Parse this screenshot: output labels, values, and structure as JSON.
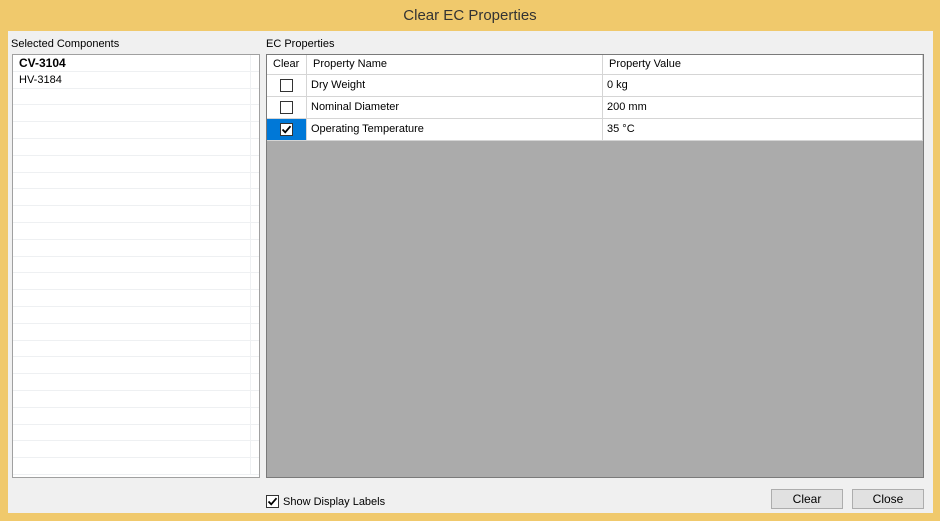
{
  "window": {
    "title": "Clear EC Properties"
  },
  "components": {
    "label": "Selected Components",
    "items": [
      "CV-3104",
      "HV-3184"
    ],
    "empty_rows": 23
  },
  "properties": {
    "label": "EC Properties",
    "columns": {
      "clear": "Clear",
      "name": "Property Name",
      "value": "Property Value"
    },
    "rows": [
      {
        "clear": false,
        "name": "Dry Weight",
        "value": "0 kg"
      },
      {
        "clear": false,
        "name": "Nominal Diameter",
        "value": "200 mm"
      },
      {
        "clear": true,
        "name": "Operating Temperature",
        "value": "35 °C"
      }
    ]
  },
  "options": {
    "show_display_labels": "Show Display Labels",
    "show_display_labels_checked": true
  },
  "buttons": {
    "clear": "Clear",
    "close": "Close"
  },
  "colors": {
    "frame": "#f0c96c",
    "grid_background": "#ababab",
    "selection": "#0078d7"
  }
}
